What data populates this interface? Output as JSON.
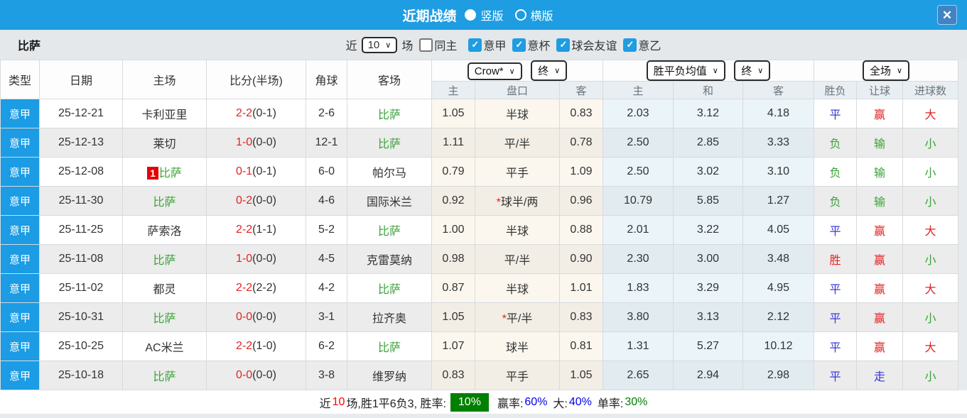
{
  "titlebar": {
    "title": "近期战绩",
    "radios": [
      {
        "label": "竖版",
        "selected": true
      },
      {
        "label": "横版",
        "selected": false
      }
    ],
    "close_glyph": "✕"
  },
  "filterbar": {
    "team": "比萨",
    "near_label": "近",
    "games_value": "10",
    "games_label": "场",
    "checkboxes": [
      {
        "label": "同主",
        "checked": false
      },
      {
        "label": "意甲",
        "checked": true
      },
      {
        "label": "意杯",
        "checked": true
      },
      {
        "label": "球会友谊",
        "checked": true
      },
      {
        "label": "意乙",
        "checked": true
      }
    ]
  },
  "table": {
    "left_headers": [
      "类型",
      "日期",
      "主场",
      "比分(半场)",
      "角球",
      "客场"
    ],
    "odds_header": {
      "bookmaker": "Crow*",
      "time": "终",
      "cols": [
        "主",
        "盘口",
        "客"
      ]
    },
    "europe_header": {
      "label": "胜平负均值",
      "time": "终",
      "cols": [
        "主",
        "和",
        "客"
      ]
    },
    "result_header": {
      "scope": "全场",
      "cols": [
        "胜负",
        "让球",
        "进球数"
      ]
    },
    "rows": [
      {
        "league": "意甲",
        "date": "25-12-21",
        "home": {
          "text": "卡利亚里",
          "color": "dark",
          "badge": ""
        },
        "score_main": "2-2",
        "score_half": "(0-1)",
        "corner": "2-6",
        "away": {
          "text": "比萨",
          "color": "green"
        },
        "ah_home": "1.05",
        "handicap": {
          "star": false,
          "text": "半球"
        },
        "ah_away": "0.83",
        "eu_home": "2.03",
        "eu_draw": "3.12",
        "eu_away": "4.18",
        "wdl": {
          "text": "平",
          "color": "blue"
        },
        "let": {
          "text": "赢",
          "color": "red"
        },
        "goals": {
          "text": "大",
          "color": "red"
        }
      },
      {
        "league": "意甲",
        "date": "25-12-13",
        "home": {
          "text": "莱切",
          "color": "dark",
          "badge": ""
        },
        "score_main": "1-0",
        "score_half": "(0-0)",
        "corner": "12-1",
        "away": {
          "text": "比萨",
          "color": "green"
        },
        "ah_home": "1.11",
        "handicap": {
          "star": false,
          "text": "平/半"
        },
        "ah_away": "0.78",
        "eu_home": "2.50",
        "eu_draw": "2.85",
        "eu_away": "3.33",
        "wdl": {
          "text": "负",
          "color": "green"
        },
        "let": {
          "text": "输",
          "color": "green"
        },
        "goals": {
          "text": "小",
          "color": "green"
        }
      },
      {
        "league": "意甲",
        "date": "25-12-08",
        "home": {
          "text": "比萨",
          "color": "green",
          "badge": "1"
        },
        "score_main": "0-1",
        "score_half": "(0-1)",
        "corner": "6-0",
        "away": {
          "text": "帕尔马",
          "color": "dark"
        },
        "ah_home": "0.79",
        "handicap": {
          "star": false,
          "text": "平手"
        },
        "ah_away": "1.09",
        "eu_home": "2.50",
        "eu_draw": "3.02",
        "eu_away": "3.10",
        "wdl": {
          "text": "负",
          "color": "green"
        },
        "let": {
          "text": "输",
          "color": "green"
        },
        "goals": {
          "text": "小",
          "color": "green"
        }
      },
      {
        "league": "意甲",
        "date": "25-11-30",
        "home": {
          "text": "比萨",
          "color": "green",
          "badge": ""
        },
        "score_main": "0-2",
        "score_half": "(0-0)",
        "corner": "4-6",
        "away": {
          "text": "国际米兰",
          "color": "dark"
        },
        "ah_home": "0.92",
        "handicap": {
          "star": true,
          "text": "球半/两"
        },
        "ah_away": "0.96",
        "eu_home": "10.79",
        "eu_draw": "5.85",
        "eu_away": "1.27",
        "wdl": {
          "text": "负",
          "color": "green"
        },
        "let": {
          "text": "输",
          "color": "green"
        },
        "goals": {
          "text": "小",
          "color": "green"
        }
      },
      {
        "league": "意甲",
        "date": "25-11-25",
        "home": {
          "text": "萨索洛",
          "color": "dark",
          "badge": ""
        },
        "score_main": "2-2",
        "score_half": "(1-1)",
        "corner": "5-2",
        "away": {
          "text": "比萨",
          "color": "green"
        },
        "ah_home": "1.00",
        "handicap": {
          "star": false,
          "text": "半球"
        },
        "ah_away": "0.88",
        "eu_home": "2.01",
        "eu_draw": "3.22",
        "eu_away": "4.05",
        "wdl": {
          "text": "平",
          "color": "blue"
        },
        "let": {
          "text": "赢",
          "color": "red"
        },
        "goals": {
          "text": "大",
          "color": "red"
        }
      },
      {
        "league": "意甲",
        "date": "25-11-08",
        "home": {
          "text": "比萨",
          "color": "green",
          "badge": ""
        },
        "score_main": "1-0",
        "score_half": "(0-0)",
        "corner": "4-5",
        "away": {
          "text": "克雷莫纳",
          "color": "dark"
        },
        "ah_home": "0.98",
        "handicap": {
          "star": false,
          "text": "平/半"
        },
        "ah_away": "0.90",
        "eu_home": "2.30",
        "eu_draw": "3.00",
        "eu_away": "3.48",
        "wdl": {
          "text": "胜",
          "color": "red"
        },
        "let": {
          "text": "赢",
          "color": "red"
        },
        "goals": {
          "text": "小",
          "color": "green"
        }
      },
      {
        "league": "意甲",
        "date": "25-11-02",
        "home": {
          "text": "都灵",
          "color": "dark",
          "badge": ""
        },
        "score_main": "2-2",
        "score_half": "(2-2)",
        "corner": "4-2",
        "away": {
          "text": "比萨",
          "color": "green"
        },
        "ah_home": "0.87",
        "handicap": {
          "star": false,
          "text": "半球"
        },
        "ah_away": "1.01",
        "eu_home": "1.83",
        "eu_draw": "3.29",
        "eu_away": "4.95",
        "wdl": {
          "text": "平",
          "color": "blue"
        },
        "let": {
          "text": "赢",
          "color": "red"
        },
        "goals": {
          "text": "大",
          "color": "red"
        }
      },
      {
        "league": "意甲",
        "date": "25-10-31",
        "home": {
          "text": "比萨",
          "color": "green",
          "badge": ""
        },
        "score_main": "0-0",
        "score_half": "(0-0)",
        "corner": "3-1",
        "away": {
          "text": "拉齐奥",
          "color": "dark"
        },
        "ah_home": "1.05",
        "handicap": {
          "star": true,
          "text": "平/半"
        },
        "ah_away": "0.83",
        "eu_home": "3.80",
        "eu_draw": "3.13",
        "eu_away": "2.12",
        "wdl": {
          "text": "平",
          "color": "blue"
        },
        "let": {
          "text": "赢",
          "color": "red"
        },
        "goals": {
          "text": "小",
          "color": "green"
        }
      },
      {
        "league": "意甲",
        "date": "25-10-25",
        "home": {
          "text": "AC米兰",
          "color": "dark",
          "badge": ""
        },
        "score_main": "2-2",
        "score_half": "(1-0)",
        "corner": "6-2",
        "away": {
          "text": "比萨",
          "color": "green"
        },
        "ah_home": "1.07",
        "handicap": {
          "star": false,
          "text": "球半"
        },
        "ah_away": "0.81",
        "eu_home": "1.31",
        "eu_draw": "5.27",
        "eu_away": "10.12",
        "wdl": {
          "text": "平",
          "color": "blue"
        },
        "let": {
          "text": "赢",
          "color": "red"
        },
        "goals": {
          "text": "大",
          "color": "red"
        }
      },
      {
        "league": "意甲",
        "date": "25-10-18",
        "home": {
          "text": "比萨",
          "color": "green",
          "badge": ""
        },
        "score_main": "0-0",
        "score_half": "(0-0)",
        "corner": "3-8",
        "away": {
          "text": "维罗纳",
          "color": "dark"
        },
        "ah_home": "0.83",
        "handicap": {
          "star": false,
          "text": "平手"
        },
        "ah_away": "1.05",
        "eu_home": "2.65",
        "eu_draw": "2.94",
        "eu_away": "2.98",
        "wdl": {
          "text": "平",
          "color": "blue"
        },
        "let": {
          "text": "走",
          "color": "blue"
        },
        "goals": {
          "text": "小",
          "color": "green"
        }
      }
    ]
  },
  "footer": {
    "segments": [
      {
        "text": "近",
        "style": "dark"
      },
      {
        "text": "10",
        "style": "red"
      },
      {
        "text": "场,胜1平6负3, 胜率:",
        "style": "dark"
      },
      {
        "text": "10%",
        "style": "badge"
      },
      {
        "text": "赢率:",
        "style": "dark gap"
      },
      {
        "text": "60%",
        "style": "blue"
      },
      {
        "text": "大:",
        "style": "dark gap"
      },
      {
        "text": "40%",
        "style": "blue"
      },
      {
        "text": "单率:",
        "style": "dark gap"
      },
      {
        "text": "30%",
        "style": "green"
      }
    ]
  }
}
